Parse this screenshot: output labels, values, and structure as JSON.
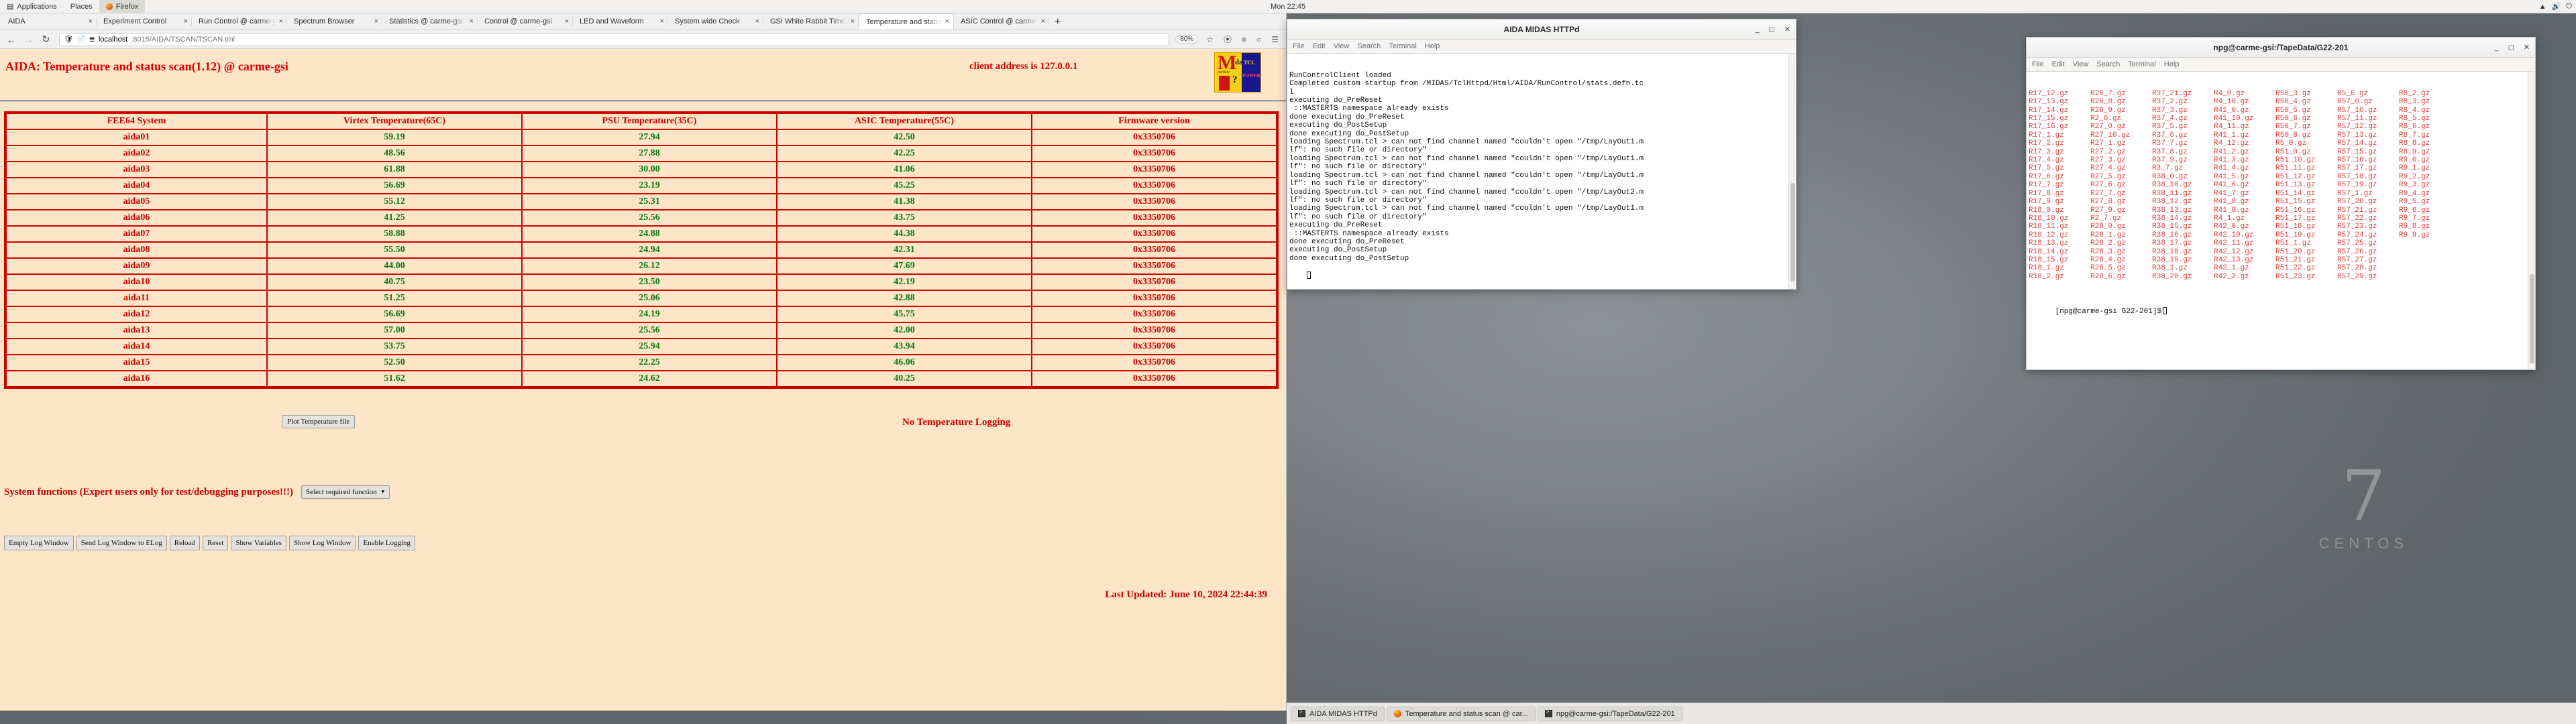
{
  "topbar": {
    "applications": "Applications",
    "places": "Places",
    "firefox": "Firefox",
    "clock": "Mon 22:45",
    "tray_items": [
      "network-icon",
      "volume-icon",
      "power-icon"
    ]
  },
  "firefox": {
    "tabs": [
      {
        "label": "AIDA",
        "selected": false
      },
      {
        "label": "Experiment Control",
        "selected": false
      },
      {
        "label": "Run Control @ carme-gsi",
        "selected": false
      },
      {
        "label": "Spectrum Browser",
        "selected": false
      },
      {
        "label": "Statistics @ carme-gsi",
        "selected": false
      },
      {
        "label": "Control @ carme-gsi",
        "selected": false
      },
      {
        "label": "LED and Waveform",
        "selected": false
      },
      {
        "label": "System wide Check",
        "selected": false
      },
      {
        "label": "GSI White Rabbit Time",
        "selected": false
      },
      {
        "label": "Temperature and status scan",
        "selected": true
      },
      {
        "label": "ASIC Control @ carme-gsi",
        "selected": false
      }
    ],
    "new_tab_label": "+",
    "close_label": "×",
    "nav": {
      "back": "←",
      "forward": "→",
      "reload": "↻"
    },
    "url_host": "localhost",
    "url_rest": ":8015/AIDA/TSCAN/TSCAN.tml",
    "zoom_level": "80%",
    "bookmark_icon": "star-icon",
    "save_to_pocket_icon": "pocket-icon",
    "menu_icon": "hamburger-icon"
  },
  "page": {
    "title": "AIDA: Temperature and status scan(1.12) @ carme-gsi",
    "client_address": "client address is 127.0.0.1",
    "logo": {
      "m": "M",
      "das": "das",
      "sm": "particle",
      "q": "?",
      "tcl": "TCL",
      "powered": "POWERED"
    },
    "table": {
      "headers": [
        "FEE64 System",
        "Virtex Temperature(65C)",
        "PSU Temperature(35C)",
        "ASIC Temperature(55C)",
        "Firmware version"
      ],
      "rows": [
        [
          "aida01",
          "59.19",
          "27.94",
          "42.50",
          "0x3350706"
        ],
        [
          "aida02",
          "48.56",
          "27.88",
          "42.25",
          "0x3350706"
        ],
        [
          "aida03",
          "61.88",
          "30.00",
          "41.06",
          "0x3350706"
        ],
        [
          "aida04",
          "56.69",
          "23.19",
          "45.25",
          "0x3350706"
        ],
        [
          "aida05",
          "55.12",
          "25.31",
          "41.38",
          "0x3350706"
        ],
        [
          "aida06",
          "41.25",
          "25.56",
          "43.75",
          "0x3350706"
        ],
        [
          "aida07",
          "58.88",
          "24.88",
          "44.38",
          "0x3350706"
        ],
        [
          "aida08",
          "55.50",
          "24.94",
          "42.31",
          "0x3350706"
        ],
        [
          "aida09",
          "44.00",
          "26.12",
          "47.69",
          "0x3350706"
        ],
        [
          "aida10",
          "40.75",
          "23.50",
          "42.19",
          "0x3350706"
        ],
        [
          "aida11",
          "51.25",
          "25.06",
          "42.88",
          "0x3350706"
        ],
        [
          "aida12",
          "56.69",
          "24.19",
          "45.75",
          "0x3350706"
        ],
        [
          "aida13",
          "57.00",
          "25.56",
          "42.00",
          "0x3350706"
        ],
        [
          "aida14",
          "53.75",
          "25.94",
          "43.94",
          "0x3350706"
        ],
        [
          "aida15",
          "52.50",
          "22.25",
          "46.06",
          "0x3350706"
        ],
        [
          "aida16",
          "51.62",
          "24.62",
          "40.25",
          "0x3350706"
        ]
      ]
    },
    "plot_button": "Plot Temperature file",
    "logging_status": "No Temperature Logging",
    "system_functions_label": "System functions (Expert users only for test/debugging purposes!!!)",
    "system_functions_select": "Select required function",
    "buttons": [
      "Empty Log Window",
      "Send Log Window to ELog",
      "Reload",
      "Reset",
      "Show Variables",
      "Show Log Window",
      "Enable Logging"
    ],
    "last_updated": "Last Updated: June 10, 2024 22:44:39"
  },
  "terminal_midas": {
    "title": "AIDA MIDAS HTTPd",
    "menu": [
      "File",
      "Edit",
      "View",
      "Search",
      "Terminal",
      "Help"
    ],
    "window_buttons": [
      "minimize",
      "maximize",
      "close"
    ],
    "lines": [
      "RunControlClient loaded",
      "Completed custom startup from /MIDAS/TclHttpd/Html/AIDA/RunControl/stats.defn.tc",
      "l",
      "executing do_PreReset",
      " ::MASTERTS namespace already exists",
      "done executing do_PreReset",
      "executing do_PostSetup",
      "done executing do_PostSetup",
      "loading Spectrum.tcl > can not find channel named \"couldn't open \"/tmp/LayOut1.m",
      "lf\": no such file or directory\"",
      "loading Spectrum.tcl > can not find channel named \"couldn't open \"/tmp/LayOut1.m",
      "lf\": no such file or directory\"",
      "loading Spectrum.tcl > can not find channel named \"couldn't open \"/tmp/LayOut1.m",
      "lf\": no such file or directory\"",
      "loading Spectrum.tcl > can not find channel named \"couldn't open \"/tmp/LayOut2.m",
      "lf\": no such file or directory\"",
      "loading Spectrum.tcl > can not find channel named \"couldn't open \"/tmp/LayOut1.m",
      "lf\": no such file or directory\"",
      "executing do_PreReset",
      " ::MASTERTS namespace already exists",
      "done executing do_PreReset",
      "executing do_PostSetup",
      "done executing do_PostSetup"
    ]
  },
  "terminal_npg": {
    "title": "npg@carme-gsi:/TapeData/G22-201",
    "menu": [
      "File",
      "Edit",
      "View",
      "Search",
      "Terminal",
      "Help"
    ],
    "window_buttons": [
      "minimize",
      "maximize",
      "close"
    ],
    "files": [
      "R17_12.gz",
      "R26_7.gz",
      "R37_21.gz",
      "R4_0.gz",
      "R50_3.gz",
      "R5_6.gz",
      "R8_2.gz",
      "R17_13.gz",
      "R26_8.gz",
      "R37_2.gz",
      "R4_10.gz",
      "R50_4.gz",
      "R57_0.gz",
      "R8_3.gz",
      "R17_14.gz",
      "R26_9.gz",
      "R37_3.gz",
      "R41_0.gz",
      "R50_5.gz",
      "R57_10.gz",
      "R8_4.gz",
      "R17_15.gz",
      "R2_6.gz",
      "R37_4.gz",
      "R41_10.gz",
      "R50_6.gz",
      "R57_11.gz",
      "R8_5.gz",
      "R17_16.gz",
      "R27_0.gz",
      "R37_5.gz",
      "R4_11.gz",
      "R50_7.gz",
      "R57_12.gz",
      "R8_6.gz",
      "R17_1.gz",
      "R27_10.gz",
      "R37_6.gz",
      "R41_1.gz",
      "R50_8.gz",
      "R57_13.gz",
      "R8_7.gz",
      "R17_2.gz",
      "R27_1.gz",
      "R37_7.gz",
      "R4_12.gz",
      "R5_0.gz",
      "R57_14.gz",
      "R8_8.gz",
      "R17_3.gz",
      "R27_2.gz",
      "R37_8.gz",
      "R41_2.gz",
      "R51_0.gz",
      "R57_15.gz",
      "R8_9.gz",
      "R17_4.gz",
      "R27_3.gz",
      "R37_9.gz",
      "R41_3.gz",
      "R51_10.gz",
      "R57_16.gz",
      "R9_0.gz",
      "R17_5.gz",
      "R27_4.gz",
      "R3_7.gz",
      "R41_4.gz",
      "R51_11.gz",
      "R57_17.gz",
      "R9_1.gz",
      "R17_6.gz",
      "R27_5.gz",
      "R38_0.gz",
      "R41_5.gz",
      "R51_12.gz",
      "R57_18.gz",
      "R9_2.gz",
      "R17_7.gz",
      "R27_6.gz",
      "R38_10.gz",
      "R41_6.gz",
      "R51_13.gz",
      "R57_19.gz",
      "R9_3.gz",
      "R17_8.gz",
      "R27_7.gz",
      "R38_11.gz",
      "R41_7.gz",
      "R51_14.gz",
      "R57_1.gz",
      "R9_4.gz",
      "R17_9.gz",
      "R27_8.gz",
      "R38_12.gz",
      "R41_8.gz",
      "R51_15.gz",
      "R57_20.gz",
      "R9_5.gz",
      "R18_0.gz",
      "R27_9.gz",
      "R38_13.gz",
      "R41_9.gz",
      "R51_16.gz",
      "R57_21.gz",
      "R9_6.gz",
      "R18_10.gz",
      "R2_7.gz",
      "R38_14.gz",
      "R4_1.gz",
      "R51_17.gz",
      "R57_22.gz",
      "R9_7.gz",
      "R18_11.gz",
      "R28_0.gz",
      "R38_15.gz",
      "R42_0.gz",
      "R51_18.gz",
      "R57_23.gz",
      "R9_8.gz",
      "R18_12.gz",
      "R28_1.gz",
      "R38_16.gz",
      "R42_10.gz",
      "R51_19.gz",
      "R57_24.gz",
      "R9_9.gz",
      "R18_13.gz",
      "R28_2.gz",
      "R38_17.gz",
      "R42_11.gz",
      "R51_1.gz",
      "R57_25.gz",
      "",
      "R18_14.gz",
      "R28_3.gz",
      "R38_18.gz",
      "R42_12.gz",
      "R51_20.gz",
      "R57_26.gz",
      "",
      "R18_15.gz",
      "R28_4.gz",
      "R38_19.gz",
      "R42_13.gz",
      "R51_21.gz",
      "R57_27.gz",
      "",
      "R18_1.gz",
      "R28_5.gz",
      "R38_1.gz",
      "R42_1.gz",
      "R51_22.gz",
      "R57_28.gz",
      "",
      "R18_2.gz",
      "R28_6.gz",
      "R38_20.gz",
      "R42_2.gz",
      "R51_23.gz",
      "R57_29.gz",
      ""
    ],
    "prompt": "[npg@carme-gsi G22-201]$"
  },
  "taskbar": {
    "tasks": [
      {
        "label": "AIDA MIDAS HTTPd",
        "icon": "terminal-icon"
      },
      {
        "label": "Temperature and status scan @ car...",
        "icon": "firefox-icon"
      },
      {
        "label": "npg@carme-gsi:/TapeData/G22-201",
        "icon": "terminal-icon"
      }
    ]
  },
  "desktop": {
    "logo_glyph": "7",
    "logo_word": "CENTOS"
  }
}
